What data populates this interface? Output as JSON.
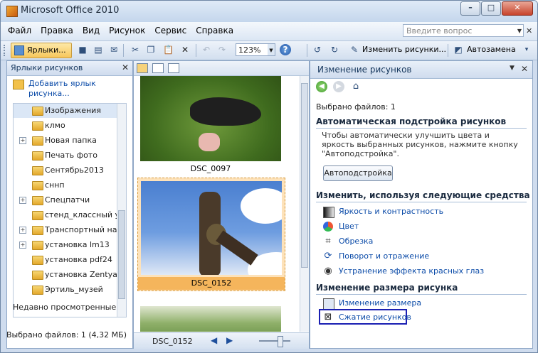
{
  "window": {
    "title": "Microsoft Office 2010",
    "minimize": "–",
    "maximize": "□",
    "close": "✕"
  },
  "menu": {
    "items": [
      "Файл",
      "Правка",
      "Вид",
      "Рисунок",
      "Сервис",
      "Справка"
    ],
    "ask_placeholder": "Введите вопрос",
    "close": "✕"
  },
  "toolbar": {
    "shortcuts_label": "Ярлыки...",
    "zoom": "123%",
    "help": "?",
    "edit_pictures_label": "Изменить рисунки...",
    "autocorrect_label": "Автозамена"
  },
  "left_pane": {
    "title": "Ярлыки рисунков",
    "close": "✕",
    "add_shortcut": "Добавить ярлык рисунка...",
    "tree": [
      {
        "label": "Изображения",
        "expand": "",
        "selected": true
      },
      {
        "label": "клмо",
        "expand": ""
      },
      {
        "label": "Новая папка",
        "expand": "+"
      },
      {
        "label": "Печать фото",
        "expand": ""
      },
      {
        "label": "Сентябрь2013",
        "expand": ""
      },
      {
        "label": "сннп",
        "expand": ""
      },
      {
        "label": "Спецпатчи",
        "expand": "+"
      },
      {
        "label": "стенд_классный уг",
        "expand": ""
      },
      {
        "label": "Транспортный нал",
        "expand": "+"
      },
      {
        "label": "установка lm13",
        "expand": "+"
      },
      {
        "label": "установка pdf24",
        "expand": ""
      },
      {
        "label": "установка Zentyal",
        "expand": ""
      },
      {
        "label": "Эртиль_музей",
        "expand": ""
      }
    ],
    "recent": "Недавно просмотренные",
    "status": "Выбрано файлов: 1 (4,32 МБ)"
  },
  "middle_pane": {
    "photos": [
      {
        "caption": "DSC_0097"
      },
      {
        "caption": "DSC_0152",
        "selected": true
      }
    ],
    "status_name": "DSC_0152",
    "prev": "◀",
    "next": "▶"
  },
  "right_pane": {
    "title": "Изменение рисунков",
    "dropdown": "▼",
    "close": "✕",
    "selected_files": "Выбрано файлов: 1",
    "auto_section": "Автоматическая подстройка рисунков",
    "auto_desc": "Чтобы автоматически улучшить цвета и яркость выбранных рисунков, нажмите кнопку \"Автоподстройка\".",
    "auto_button": "Автоподстройка",
    "tools_section": "Изменить, используя следующие средства",
    "tools": [
      "Яркость и контрастность",
      "Цвет",
      "Обрезка",
      "Поворот и отражение",
      "Устранение эффекта красных глаз"
    ],
    "resize_section": "Изменение размера рисунка",
    "resize_tools": [
      "Изменение размера",
      "Сжатие рисунков"
    ]
  }
}
